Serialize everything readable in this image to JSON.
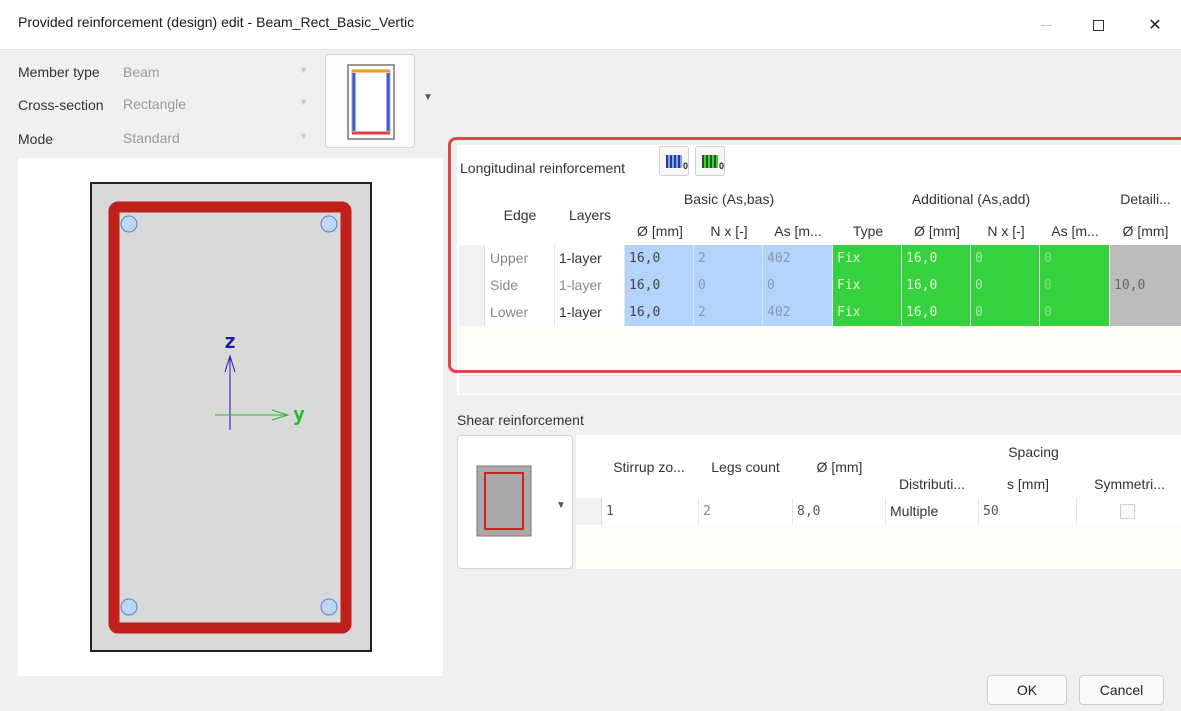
{
  "window": {
    "title": "Provided reinforcement (design) edit - Beam_Rect_Basic_Vertic"
  },
  "properties": {
    "member_type_label": "Member type",
    "member_type_value": "Beam",
    "cross_section_label": "Cross-section",
    "cross_section_value": "Rectangle",
    "mode_label": "Mode",
    "mode_value": "Standard"
  },
  "axes": {
    "z": "z",
    "y": "y"
  },
  "longitudinal": {
    "title": "Longitudinal reinforcement",
    "group_basic": "Basic (As,bas)",
    "group_additional": "Additional (As,add)",
    "group_detailing": "Detaili...",
    "col_edge": "Edge",
    "col_layers": "Layers",
    "col_basic_dia": "Ø [mm]",
    "col_basic_n": "N x [-]",
    "col_basic_as": "As [m...",
    "col_type": "Type",
    "col_add_dia": "Ø [mm]",
    "col_add_n": "N x [-]",
    "col_add_as": "As [m...",
    "col_det_dia": "Ø [mm]",
    "rows": [
      {
        "edge": "Upper",
        "layers": "1-layer",
        "basic_dia": "16,0",
        "basic_n": "2",
        "basic_as": "402",
        "type": "Fix",
        "add_dia": "16,0",
        "add_n": "0",
        "add_as": "0"
      },
      {
        "edge": "Side",
        "layers": "1-layer",
        "basic_dia": "16,0",
        "basic_n": "0",
        "basic_as": "0",
        "type": "Fix",
        "add_dia": "16,0",
        "add_n": "0",
        "add_as": "0"
      },
      {
        "edge": "Lower",
        "layers": "1-layer",
        "basic_dia": "16,0",
        "basic_n": "2",
        "basic_as": "402",
        "type": "Fix",
        "add_dia": "16,0",
        "add_n": "0",
        "add_as": "0"
      }
    ],
    "detailing_dia": "10,0"
  },
  "shear": {
    "title": "Shear reinforcement",
    "col_zone": "Stirrup zo...",
    "col_legs": "Legs count",
    "col_dia": "Ø [mm]",
    "group_spacing": "Spacing",
    "col_distribution": "Distributi...",
    "col_s": "s [mm]",
    "col_symmetric": "Symmetri...",
    "rows": [
      {
        "zone": "1",
        "legs": "2",
        "dia": "8,0",
        "distribution": "Multiple",
        "s": "50"
      }
    ]
  },
  "buttons": {
    "ok": "OK",
    "cancel": "Cancel"
  },
  "colors": {
    "basic_cell": "#b3d3fb",
    "additional_cell": "#35d13f",
    "detailing_cell": "#bcbcbc",
    "highlight_frame": "#e04848",
    "stirrup": "#c0201a"
  }
}
